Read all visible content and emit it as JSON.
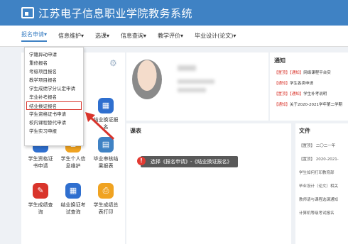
{
  "header": {
    "title": "江苏电子信息职业学院教务系统"
  },
  "nav": [
    {
      "label": "报名申请▾"
    },
    {
      "label": "信息维护▾"
    },
    {
      "label": "选课▾"
    },
    {
      "label": "信息查询▾"
    },
    {
      "label": "教学评价▾"
    },
    {
      "label": "毕业设计(论文)▾"
    }
  ],
  "dropdown": [
    "学籍异动申请",
    "重修报名",
    "考级项目报名",
    "教学项目报名",
    "学生成绩学分认定申请",
    "毕业补考报名",
    "结业换证报名",
    "学生资格证书申请",
    "校内课程替代申请",
    "学生实习申报"
  ],
  "tiles": [
    {
      "label": "结业换证报\n名",
      "color": "#2f6fcf",
      "icon": "grid-icon"
    },
    {
      "label": "学生资格证\n书申请",
      "color": "#2f6fcf",
      "icon": "certificate-icon"
    },
    {
      "label": "学生个人信\n息维护",
      "color": "#f0a321",
      "icon": "person-icon"
    },
    {
      "label": "毕业审核结\n果报表",
      "color": "#3f82c4",
      "icon": "report-icon"
    },
    {
      "label": "学生成绩查\n询",
      "color": "#d9342b",
      "icon": "search-score-icon"
    },
    {
      "label": "结业换证考\n试查询",
      "color": "#2f6fcf",
      "icon": "grid-icon"
    },
    {
      "label": "学生成绩总\n表打印",
      "color": "#f0a321",
      "icon": "print-icon"
    }
  ],
  "notice": {
    "title": "通知",
    "rows": [
      {
        "tag1": "【置顶】",
        "tag2": "【通知】",
        "text": "网络课程平台实"
      },
      {
        "tag1": "",
        "tag2": "【通知】",
        "text": "学生各类申请"
      },
      {
        "tag1": "【置顶】",
        "tag2": "【通知】",
        "text": "学生补考说明"
      },
      {
        "tag1": "",
        "tag2": "【通知】",
        "text": "关于2020-2021学年第二学期"
      }
    ]
  },
  "course": {
    "title": "课表",
    "callout": "选择《报名申请》-《结业换证报名》",
    "dot": "!"
  },
  "files": {
    "title": "文件",
    "rows": [
      "【置顶】 二〇二一年",
      "【置顶】 2020-2021-",
      "学生如何打印教育部",
      "毕业设计（论文）相关",
      "教师请与课程选课通知",
      "计算机等级考试报名"
    ]
  },
  "colors": {
    "header": "#3f82c4",
    "highlight": "#d9342b"
  }
}
